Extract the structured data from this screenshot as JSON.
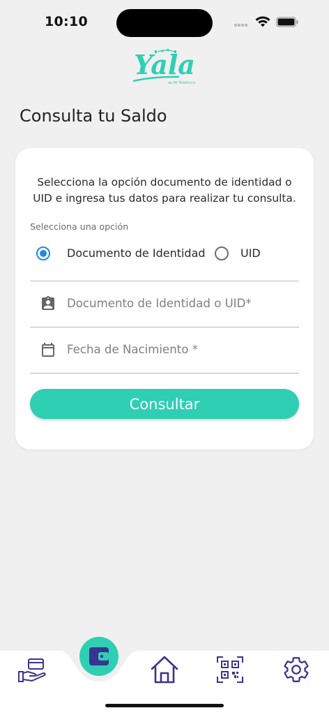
{
  "status": {
    "time": "10:10"
  },
  "page": {
    "title": "Consulta tu Saldo"
  },
  "form": {
    "instructions": "Selecciona la opción documento de identidad o UID e ingresa tus datos para realizar tu consulta.",
    "option_label": "Selecciona una opción",
    "options": [
      {
        "label": "Documento de Identidad",
        "selected": true
      },
      {
        "label": "UID",
        "selected": false
      }
    ],
    "id_placeholder": "Documento de Identidad o UID*",
    "date_placeholder": "Fecha de Nacimiento *",
    "submit_label": "Consultar"
  },
  "colors": {
    "accent": "#2ecfb3",
    "radio_selected": "#1e88e5",
    "nav_icon": "#3a3391",
    "background": "#f0f0f0"
  },
  "nav": {
    "items": [
      {
        "icon": "hand-card-icon"
      },
      {
        "icon": "wallet-icon",
        "active": true
      },
      {
        "icon": "home-icon"
      },
      {
        "icon": "qr-code-icon"
      },
      {
        "icon": "gear-icon"
      }
    ]
  }
}
